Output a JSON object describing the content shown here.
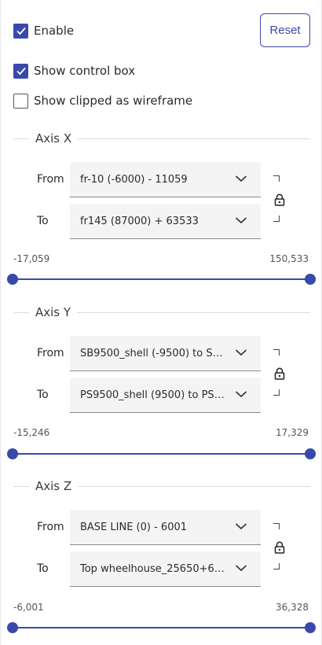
{
  "options": {
    "enable_label": "Enable",
    "enable_checked": true,
    "show_control_box_label": "Show control box",
    "show_control_box_checked": true,
    "show_clipped_label": "Show clipped as wireframe",
    "show_clipped_checked": false,
    "reset_label": "Reset"
  },
  "labels": {
    "from": "From",
    "to": "To"
  },
  "axes": [
    {
      "title": "Axis X",
      "from_value": "fr-10 (-6000) - 11059",
      "to_value": "fr145 (87000) + 63533",
      "range_min": "-17,059",
      "range_max": "150,533",
      "locked": true
    },
    {
      "title": "Axis Y",
      "from_value": "SB9500_shell (-9500) to SB ...",
      "to_value": "PS9500_shell (9500) to PS 7...",
      "range_min": "-15,246",
      "range_max": "17,329",
      "locked": true
    },
    {
      "title": "Axis Z",
      "from_value": "BASE LINE (0) - 6001",
      "to_value": "Top wheelhouse_25650+6 (...",
      "range_min": "-6,001",
      "range_max": "36,328",
      "locked": true
    }
  ],
  "colors": {
    "accent": "#3949ab",
    "field_bg": "#f4f4f4"
  },
  "icons": {
    "check": "check-icon",
    "chevron": "chevron-down-icon",
    "lock": "lock-icon"
  }
}
